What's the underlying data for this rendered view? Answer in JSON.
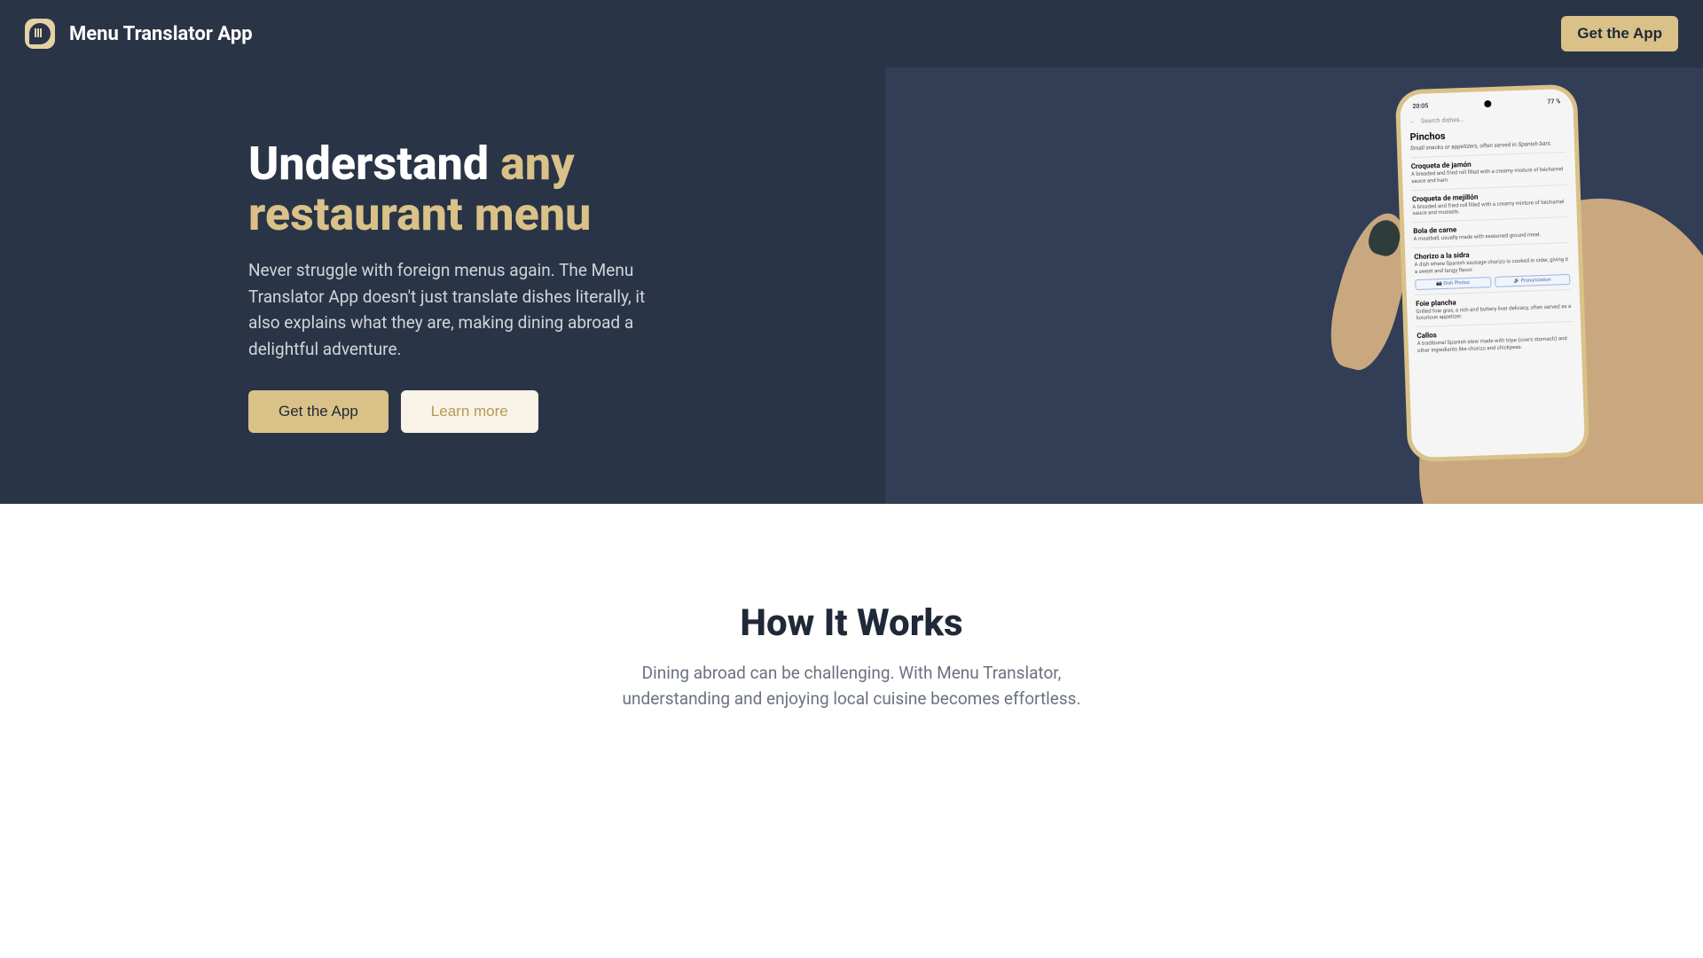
{
  "header": {
    "brand": "Menu Translator App",
    "cta": "Get the App"
  },
  "hero": {
    "title_part1": "Understand ",
    "title_part2": "any restaurant menu",
    "description": "Never struggle with foreign menus again. The Menu Translator App doesn't just translate dishes literally, it also explains what they are, making dining abroad a delightful adventure.",
    "primary_btn": "Get the App",
    "secondary_btn": "Learn more"
  },
  "phone": {
    "time": "20:05",
    "battery": "77 %",
    "search_placeholder": "Search dishes...",
    "heading": "Pinchos",
    "heading_desc": "Small snacks or appetizers, often served in Spanish bars.",
    "dishes": [
      {
        "name": "Croqueta de jamón",
        "desc": "A breaded and fried roll filled with a creamy mixture of béchamel sauce and ham."
      },
      {
        "name": "Croqueta de mejillón",
        "desc": "A breaded and fried roll filled with a creamy mixture of béchamel sauce and mussels."
      },
      {
        "name": "Bola de carne",
        "desc": "A meatball, usually made with seasoned ground meat."
      },
      {
        "name": "Chorizo a la sidra",
        "desc": "A dish where Spanish sausage chorizo is cooked in cider, giving it a sweet and tangy flavor."
      },
      {
        "name": "Foie plancha",
        "desc": "Grilled foie gras, a rich and buttery liver delicacy, often served as a luxurious appetizer."
      },
      {
        "name": "Callos",
        "desc": "A traditional Spanish stew made with tripe (cow's stomach) and other ingredients like chorizo and chickpeas."
      }
    ],
    "chip1": "📷 Dish Photos",
    "chip2": "🔊 Pronunciation"
  },
  "how": {
    "title": "How It Works",
    "subtitle": "Dining abroad can be challenging. With Menu Translator, understanding and enjoying local cuisine becomes effortless."
  }
}
